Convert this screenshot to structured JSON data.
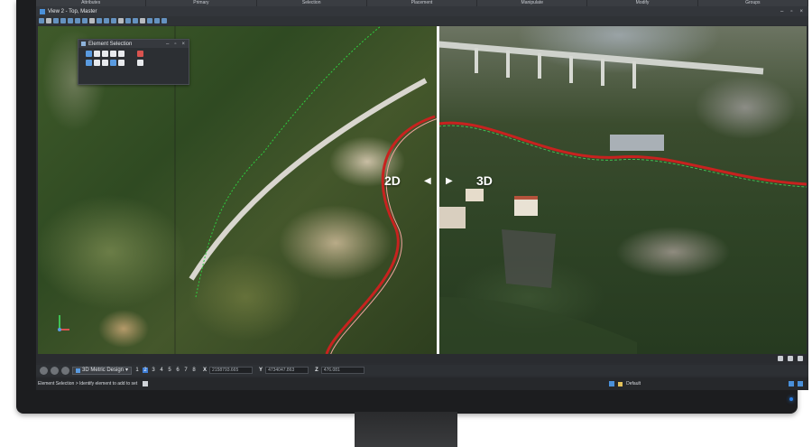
{
  "ribbon": {
    "groups": [
      "Attributes",
      "Primary",
      "Selection",
      "Placement",
      "Manipulate",
      "Modify",
      "Groups"
    ]
  },
  "view": {
    "title": "View 2 - Top, Master",
    "controls": [
      "–",
      "▫",
      "×"
    ]
  },
  "element_selection": {
    "title": "Element Selection",
    "controls": [
      "–",
      "▫",
      "×"
    ]
  },
  "viewport": {
    "label_left": "2D",
    "label_right": "3D",
    "arrow_left": "◀",
    "arrow_right": "▶"
  },
  "coords": {
    "model": "3D Metric Design",
    "view_numbers": [
      "1",
      "2",
      "3",
      "4",
      "5",
      "6",
      "7",
      "8"
    ],
    "active_view": "2",
    "x_label": "X",
    "x_value": "2158793.665",
    "y_label": "Y",
    "y_value": "4734047.863",
    "z_label": "Z",
    "z_value": "476.081"
  },
  "prompt": {
    "text": "Element Selection > Identify element to add to set",
    "level": "Default"
  },
  "colors": {
    "accent": "#3d7dd6",
    "screen_bg": "#2b2d31",
    "bezel": "#1c1d1f"
  }
}
